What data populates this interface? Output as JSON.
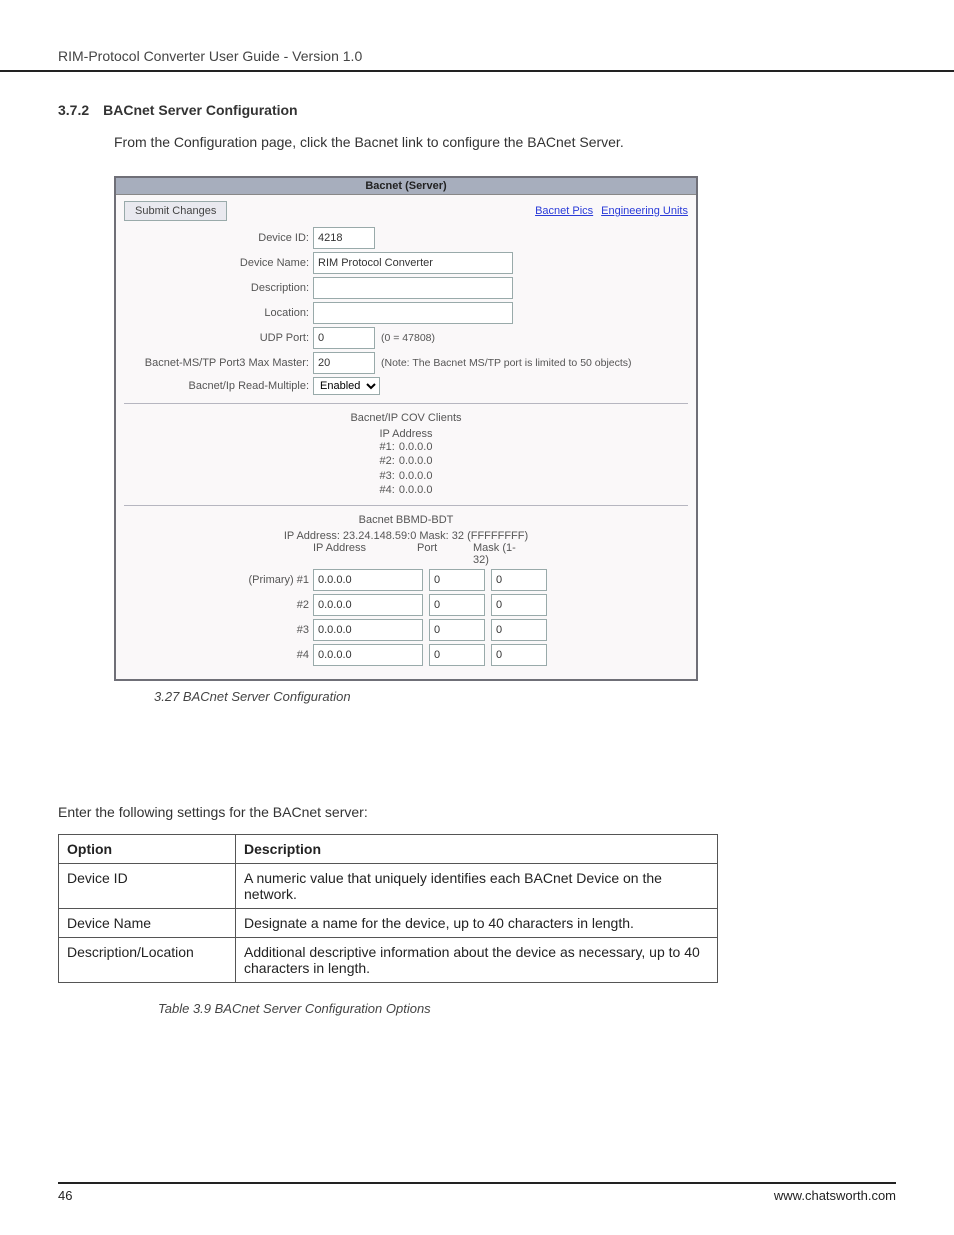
{
  "header": "RIM-Protocol Converter User Guide - Version 1.0",
  "section_num": "3.7.2",
  "section_title": "BACnet Server Configuration",
  "intro": "From the Configuration page, click the Bacnet link to configure the BACnet Server.",
  "shot": {
    "title": "Bacnet (Server)",
    "submit": "Submit Changes",
    "link_pics": "Bacnet Pics",
    "link_units": "Engineering Units",
    "fields": {
      "device_id_label": "Device ID:",
      "device_id": "4218",
      "device_name_label": "Device Name:",
      "device_name": "RIM Protocol Converter",
      "description_label": "Description:",
      "description": "",
      "location_label": "Location:",
      "location": "",
      "udp_port_label": "UDP Port:",
      "udp_port": "0",
      "udp_note": "(0 = 47808)",
      "mstp_max_label": "Bacnet-MS/TP Port3 Max Master:",
      "mstp_max": "20",
      "mstp_note": "(Note: The Bacnet MS/TP port is limited to 50 objects)",
      "read_multiple_label": "Bacnet/Ip Read-Multiple:",
      "read_multiple": "Enabled"
    },
    "cov_title": "Bacnet/IP COV Clients",
    "cov_header": "IP Address",
    "cov": [
      {
        "label": "#1:",
        "value": "0.0.0.0"
      },
      {
        "label": "#2:",
        "value": "0.0.0.0"
      },
      {
        "label": "#3:",
        "value": "0.0.0.0"
      },
      {
        "label": "#4:",
        "value": "0.0.0.0"
      }
    ],
    "bbmd_title": "Bacnet BBMD-BDT",
    "bbmd_sub": "IP Address: 23.24.148.59:0 Mask: 32 (FFFFFFFF)",
    "bbmd_head_ip": "IP Address",
    "bbmd_head_port": "Port",
    "bbmd_head_mask": "Mask (1-32)",
    "bbmd_rows": [
      {
        "label": "(Primary) #1",
        "ip": "0.0.0.0",
        "port": "0",
        "mask": "0"
      },
      {
        "label": "#2",
        "ip": "0.0.0.0",
        "port": "0",
        "mask": "0"
      },
      {
        "label": "#3",
        "ip": "0.0.0.0",
        "port": "0",
        "mask": "0"
      },
      {
        "label": "#4",
        "ip": "0.0.0.0",
        "port": "0",
        "mask": "0"
      }
    ]
  },
  "fig_caption": "3.27 BACnet Server Configuration",
  "para": "Enter the following settings for the BACnet server:",
  "table": {
    "h_option": "Option",
    "h_desc": "Description",
    "rows": [
      {
        "opt": "Device ID",
        "desc": "A numeric value that uniquely identifies each BACnet Device on the network."
      },
      {
        "opt": "Device Name",
        "desc": "Designate a name for the device, up to 40 characters in length."
      },
      {
        "opt": "Description/Location",
        "desc": "Additional descriptive information about the device as necessary, up to 40 characters in length."
      }
    ]
  },
  "table_caption": "Table 3.9 BACnet Server Configuration Options",
  "page_num": "46",
  "footer_url": "www.chatsworth.com"
}
